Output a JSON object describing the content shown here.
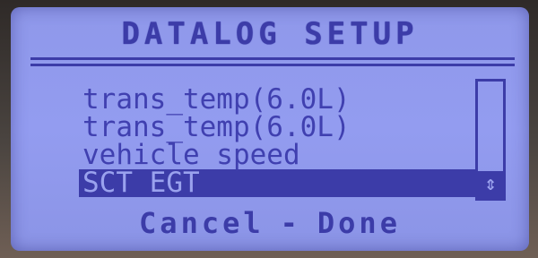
{
  "screen": {
    "title": "DATALOG SETUP"
  },
  "list": {
    "items": [
      {
        "label": "trans_temp(6.0L)",
        "selected": false
      },
      {
        "label": "trans_temp(6.0L)",
        "selected": false
      },
      {
        "label": "vehicle speed",
        "selected": false
      },
      {
        "label": "SCT EGT",
        "selected": true
      }
    ]
  },
  "scrollbar": {
    "thumb_icon": "up-down-arrows-icon",
    "thumb_glyph": "⇕"
  },
  "footer": {
    "cancel_label": "Cancel",
    "separator": "-",
    "done_label": "Done"
  },
  "colors": {
    "lcd_background": "#939cf0",
    "lcd_foreground": "#3c3ca8"
  }
}
